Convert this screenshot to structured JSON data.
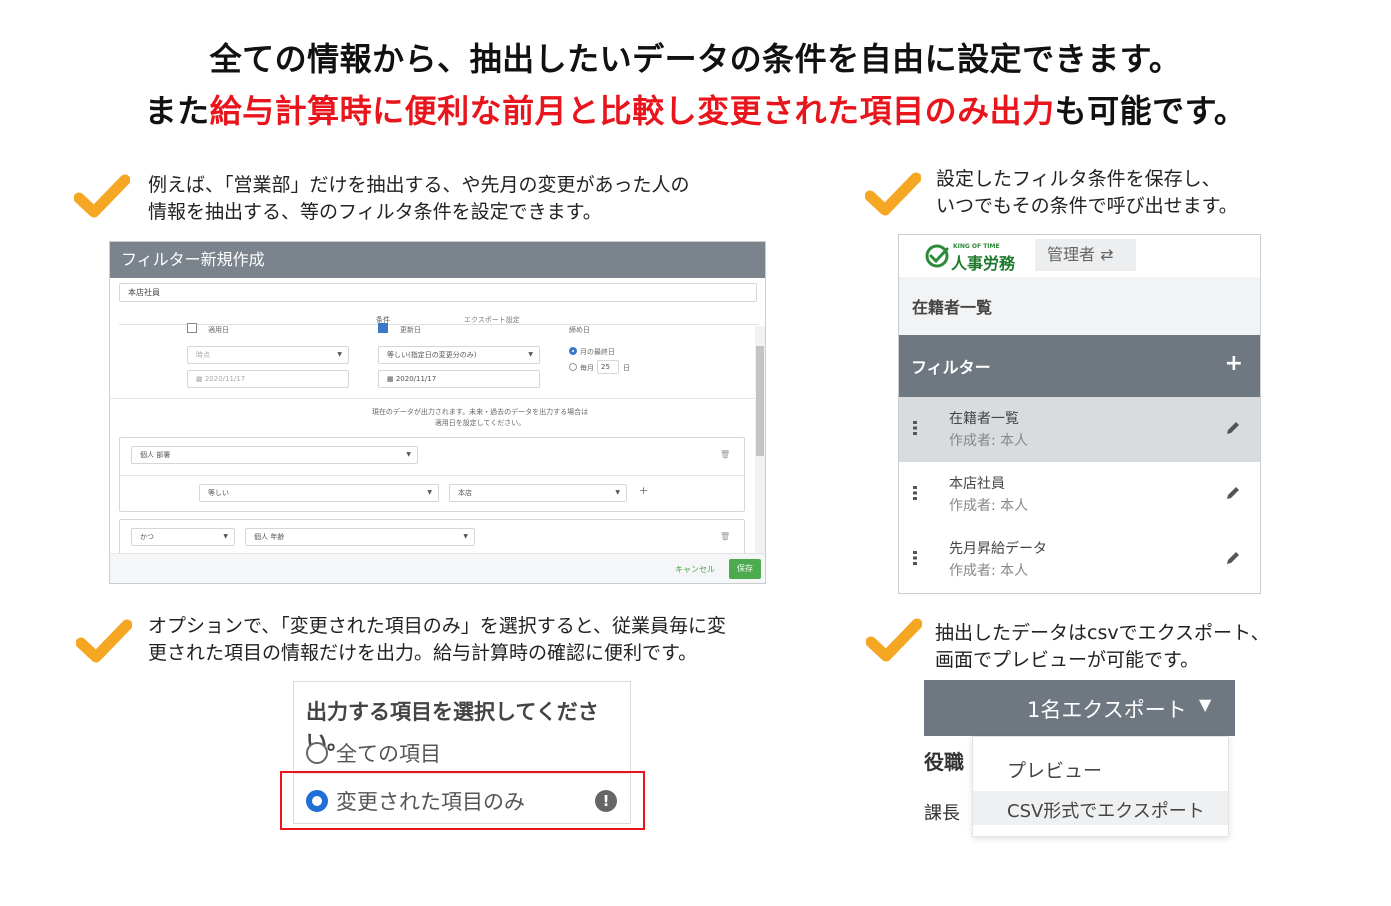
{
  "colors": {
    "accent_red": "#e8151d",
    "check_orange": "#f5a623",
    "header_gray": "#6f7880",
    "save_green": "#4caa4f",
    "brand_green": "#1f7a2e",
    "radio_blue": "#1f6fd6"
  },
  "headline": {
    "line1": "全ての情報から、抽出したいデータの条件を自由に設定できます。",
    "line2_pre": "また",
    "line2_red": "給与計算時に便利な前月と比較し変更された項目のみ出力",
    "line2_post": "も可能です。"
  },
  "captions": {
    "c1_l1": "例えば、「営業部」だけを抽出する、や先月の変更があった人の",
    "c1_l2": "情報を抽出する、等のフィルタ条件を設定できます。",
    "c2_l1": "設定したフィルタ条件を保存し、",
    "c2_l2": "いつでもその条件で呼び出せます。",
    "c3_l1": "オプションで、「変更された項目のみ」を選択すると、従業員毎に変",
    "c3_l2": "更された項目の情報だけを出力。給与計算時の確認に便利です。",
    "c4_l1": "抽出したデータはcsvでエクスポート、",
    "c4_l2": "画面でプレビューが可能です。"
  },
  "filter_form": {
    "title": "フィルター新規作成",
    "name_value": "本店社員",
    "tab_condition": "条件",
    "tab_export": "エクスポート設定",
    "apply_date_label": "適用日",
    "change_date_label": "更新日",
    "close_date_label": "締め日",
    "apply_select": "時点",
    "change_select": "等しい(指定日の変更分のみ)",
    "apply_date": "2020/11/17",
    "change_date": "2020/11/17",
    "radio_month_end": "月の最終日",
    "radio_monthly": "毎月",
    "monthly_day": "25",
    "day_suffix": "日",
    "note_l1": "現在のデータが出力されます。未来・過去のデータを出力する場合は",
    "note_l2": "適用日を設定してください。",
    "field1": "個人 部署",
    "op1": "等しい",
    "value1": "本店",
    "conj": "かつ",
    "field2": "個人 年齢",
    "cancel": "キャンセル",
    "save": "保存"
  },
  "filter_list": {
    "brand_small": "KING OF TIME",
    "brand": "人事労務",
    "role": "管理者 ⇄",
    "page_title": "在籍者一覧",
    "section": "フィルター",
    "add_icon": "+",
    "items": [
      {
        "name": "在籍者一覧",
        "creator": "作成者: 本人"
      },
      {
        "name": "本店社員",
        "creator": "作成者: 本人"
      },
      {
        "name": "先月昇給データ",
        "creator": "作成者: 本人"
      }
    ]
  },
  "output_select": {
    "title": "出力する項目を選択してください。",
    "option_all": "全ての項目",
    "option_changed": "変更された項目のみ",
    "selected": "変更された項目のみ",
    "info_icon": "!"
  },
  "export": {
    "button": "1名エクスポート",
    "back_col1": "役職",
    "back_col2": "課長",
    "menu_preview": "プレビュー",
    "menu_csv": "CSV形式でエクスポート"
  }
}
